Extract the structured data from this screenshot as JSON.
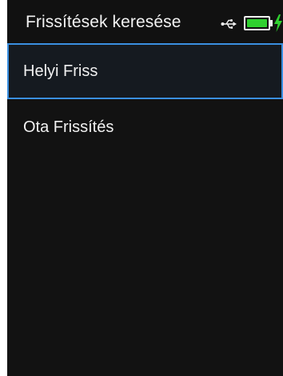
{
  "header": {
    "title": "Frissítések keresése",
    "usb_icon": "usb-icon",
    "battery_icon": "battery-icon",
    "charging_icon": "bolt-icon",
    "battery_level": 1.0,
    "battery_color": "#2fd02f"
  },
  "menu": {
    "items": [
      {
        "label": "Helyi Friss",
        "selected": true
      },
      {
        "label": "Ota Frissítés",
        "selected": false
      }
    ],
    "selection_color": "#3a8fe0"
  }
}
